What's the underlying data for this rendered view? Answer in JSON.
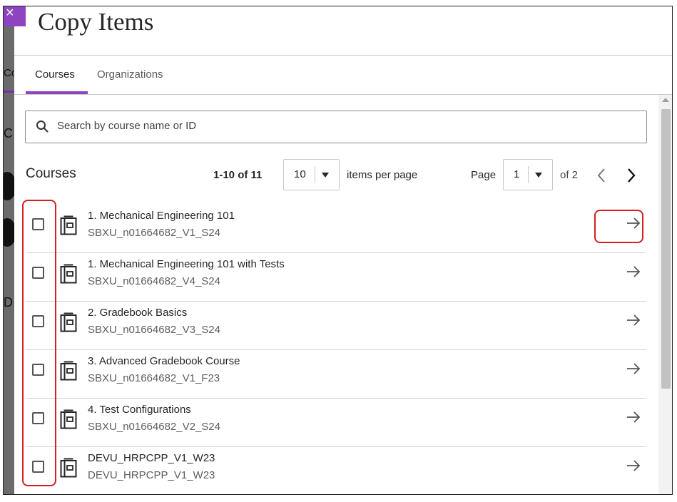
{
  "modal": {
    "title": "Copy Items"
  },
  "tabs": [
    {
      "label": "Courses",
      "active": true
    },
    {
      "label": "Organizations",
      "active": false
    }
  ],
  "search": {
    "placeholder": "Search by course name or ID",
    "value": ""
  },
  "list": {
    "title": "Courses",
    "range": "1-10 of 11",
    "per_page_value": "10",
    "per_page_label": "items per page",
    "page_label": "Page",
    "page_value": "1",
    "page_total": "of 2"
  },
  "courses": [
    {
      "name": "1. Mechanical Engineering 101",
      "id": "SBXU_n01664682_V1_S24"
    },
    {
      "name": "1. Mechanical Engineering 101 with Tests",
      "id": "SBXU_n01664682_V4_S24"
    },
    {
      "name": "2. Gradebook Basics",
      "id": "SBXU_n01664682_V3_S24"
    },
    {
      "name": "3. Advanced Gradebook Course",
      "id": "SBXU_n01664682_V1_F23"
    },
    {
      "name": "4. Test Configurations",
      "id": "SBXU_n01664682_V2_S24"
    },
    {
      "name": "DEVU_HRPCPP_V1_W23",
      "id": "DEVU_HRPCPP_V1_W23"
    }
  ],
  "backdrop": {
    "fragments": [
      "Co",
      "C",
      "D"
    ]
  },
  "colors": {
    "accent": "#8e44c0",
    "highlight": "#d32020"
  },
  "icons": {
    "close": "close-icon",
    "search": "search-icon",
    "course": "course-book-icon",
    "open": "arrow-right-icon",
    "prev": "chevron-left-icon",
    "next": "chevron-right-icon"
  }
}
